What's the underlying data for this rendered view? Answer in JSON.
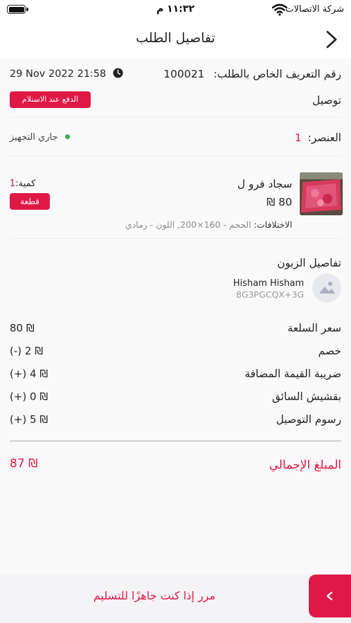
{
  "status_bar": {
    "carrier": "شركة الاتصالات",
    "time": "١١:٣٢ م"
  },
  "nav": {
    "title": "تفاصيل الطلب"
  },
  "order": {
    "id_label": "رقم التعريف الخاص بالطلب:",
    "id_value": "100021",
    "datetime": "29 Nov 2022  21:58",
    "delivery_label": "توصيل",
    "payment_badge": "الدفع عند الاستلام",
    "item_label": "العنصر:",
    "item_count": "1",
    "status_text": "جاري التجهيز",
    "status_color": "#3cb043"
  },
  "product": {
    "name": "سجاد فرو ل",
    "price": "80 ₪",
    "qty_label": "كمية:",
    "qty_value": "1",
    "unit_badge": "قطعة",
    "variations_label": "الاختلافات:",
    "variations_value": "الحجم - 160×200,  اللون - رمادي"
  },
  "customer": {
    "section_title": "تفاصيل الزبون",
    "name": "Hisham Hisham",
    "code": "8G3PGCQX+3G"
  },
  "summary": {
    "rows": [
      {
        "label": "سعر السلعة",
        "value": "80 ₪"
      },
      {
        "label": "خصم",
        "value": "(-) 2 ₪"
      },
      {
        "label": "ضريبة القيمة المضافة",
        "value": "(+) 4 ₪"
      },
      {
        "label": "بقشيش السائق",
        "value": "(+) 0 ₪"
      },
      {
        "label": "رسوم التوصيل",
        "value": "(+) 5 ₪"
      }
    ],
    "total_label": "المبلغ الإجمالي",
    "total_value": "87 ₪"
  },
  "bottom_bar": {
    "swipe_text": "مرر إذا كنت جاهزًا للتسليم"
  },
  "colors": {
    "accent": "#e01845",
    "background": "#f9f9f9"
  }
}
